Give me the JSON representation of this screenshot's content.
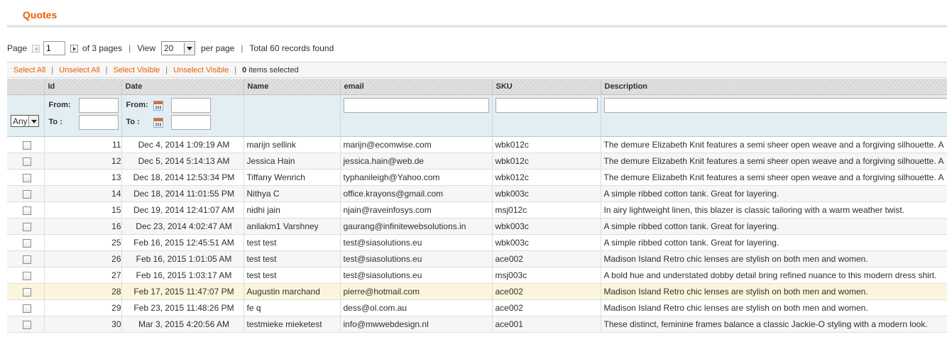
{
  "page": {
    "title": "Quotes"
  },
  "pager": {
    "page_label": "Page",
    "current_page": "1",
    "of_pages": "of 3 pages",
    "view_label": "View",
    "per_page": "20",
    "per_page_label": "per page",
    "total": "Total 60 records found"
  },
  "massaction": {
    "select_all": "Select All",
    "unselect_all": "Unselect All",
    "select_visible": "Select Visible",
    "unselect_visible": "Unselect Visible",
    "count": "0",
    "count_label": "items selected",
    "separator": "|"
  },
  "columns": {
    "id": "Id",
    "date": "Date",
    "name": "Name",
    "email": "email",
    "sku": "SKU",
    "description": "Description"
  },
  "filters": {
    "any": "Any",
    "from": "From:",
    "to": "To :"
  },
  "colors": {
    "accent": "#eb5e00",
    "highlight_row": "#fcf5dd",
    "filter_bg": "#e3eef3"
  },
  "rows": [
    {
      "id": "11",
      "date": "Dec 4, 2014 1:09:19 AM",
      "name": "marijn sellink",
      "email": "marijn@ecomwise.com",
      "sku": "wbk012c",
      "description": "The demure Elizabeth Knit features a semi sheer open weave and a forgiving silhouette. A"
    },
    {
      "id": "12",
      "date": "Dec 5, 2014 5:14:13 AM",
      "name": "Jessica Hain",
      "email": "jessica.hain@web.de",
      "sku": "wbk012c",
      "description": "The demure Elizabeth Knit features a semi sheer open weave and a forgiving silhouette. A"
    },
    {
      "id": "13",
      "date": "Dec 18, 2014 12:53:34 PM",
      "name": "Tiffany Wenrich",
      "email": "typhanileigh@Yahoo.com",
      "sku": "wbk012c",
      "description": "The demure Elizabeth Knit features a semi sheer open weave and a forgiving silhouette. A"
    },
    {
      "id": "14",
      "date": "Dec 18, 2014 11:01:55 PM",
      "name": "Nithya C",
      "email": "office.krayons@gmail.com",
      "sku": "wbk003c",
      "description": "A simple ribbed cotton tank. Great for layering."
    },
    {
      "id": "15",
      "date": "Dec 19, 2014 12:41:07 AM",
      "name": "nidhi jain",
      "email": "njain@raveinfosys.com",
      "sku": "msj012c",
      "description": "In airy lightweight linen, this blazer is classic tailoring with a warm weather twist."
    },
    {
      "id": "16",
      "date": "Dec 23, 2014 4:02:47 AM",
      "name": "anilakm1 Varshney",
      "email": "gaurang@infinitewebsolutions.in",
      "sku": "wbk003c",
      "description": "A simple ribbed cotton tank. Great for layering."
    },
    {
      "id": "25",
      "date": "Feb 16, 2015 12:45:51 AM",
      "name": "test test",
      "email": "test@siasolutions.eu",
      "sku": "wbk003c",
      "description": "A simple ribbed cotton tank. Great for layering."
    },
    {
      "id": "26",
      "date": "Feb 16, 2015 1:01:05 AM",
      "name": "test test",
      "email": "test@siasolutions.eu",
      "sku": "ace002",
      "description": "Madison Island Retro chic lenses are stylish on both men and women."
    },
    {
      "id": "27",
      "date": "Feb 16, 2015 1:03:17 AM",
      "name": "test test",
      "email": "test@siasolutions.eu",
      "sku": "msj003c",
      "description": "A bold hue and understated dobby detail bring refined nuance to this modern dress shirt."
    },
    {
      "id": "28",
      "date": "Feb 17, 2015 11:47:07 PM",
      "name": "Augustin marchand",
      "email": "pierre@hotmail.com",
      "sku": "ace002",
      "description": "Madison Island Retro chic lenses are stylish on both men and women."
    },
    {
      "id": "29",
      "date": "Feb 23, 2015 11:48:26 PM",
      "name": "fe q",
      "email": "dess@ol.com.au",
      "sku": "ace002",
      "description": "Madison Island Retro chic lenses are stylish on both men and women."
    },
    {
      "id": "30",
      "date": "Mar 3, 2015 4:20:56 AM",
      "name": "testmieke mieketest",
      "email": "info@mwwebdesign.nl",
      "sku": "ace001",
      "description": "These distinct, feminine frames balance a classic Jackie-O styling with a modern look."
    }
  ]
}
